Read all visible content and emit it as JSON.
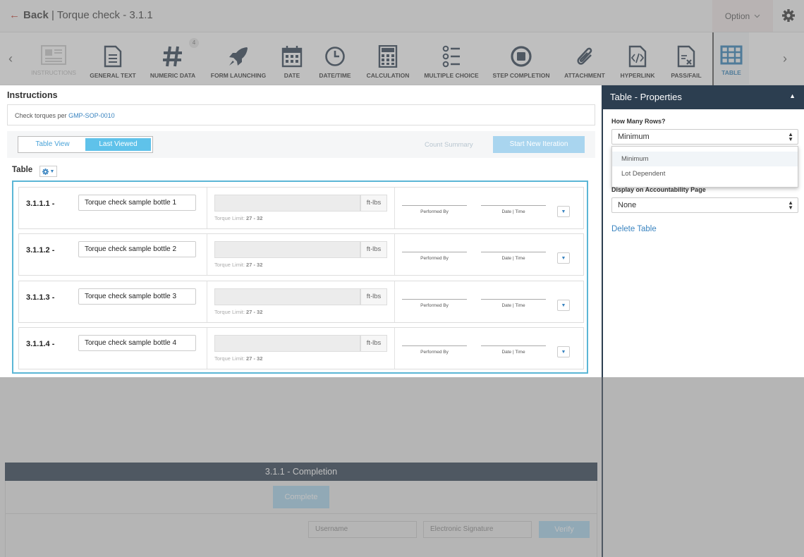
{
  "header": {
    "back_label": "Back",
    "title": "| Torque check - 3.1.1",
    "option_label": "Option"
  },
  "toolbar": {
    "items": [
      {
        "label": "INSTRUCTIONS"
      },
      {
        "label": "GENERAL TEXT"
      },
      {
        "label": "NUMERIC DATA",
        "badge": "4"
      },
      {
        "label": "FORM LAUNCHING"
      },
      {
        "label": "DATE"
      },
      {
        "label": "DATE/TIME"
      },
      {
        "label": "CALCULATION"
      },
      {
        "label": "MULTIPLE CHOICE"
      },
      {
        "label": "STEP COMPLETION"
      },
      {
        "label": "ATTACHMENT"
      },
      {
        "label": "HYPERLINK"
      },
      {
        "label": "PASS/FAIL"
      },
      {
        "label": "TABLE"
      }
    ]
  },
  "instructions": {
    "heading": "Instructions",
    "text": "Check torques per",
    "link": "GMP-SOP-0010"
  },
  "view_bar": {
    "table_view": "Table View",
    "last_viewed": "Last Viewed",
    "count_summary": "Count Summary",
    "start_iteration": "Start New Iteration"
  },
  "table": {
    "heading": "Table",
    "rows": [
      {
        "id": "3.1.1.1 -",
        "name": "Torque check sample bottle 1",
        "unit": "ft-lbs",
        "limit_label": "Torque Limit:",
        "limit_value": "27 - 32",
        "performed_by": "Performed By",
        "date_time": "Date | Time"
      },
      {
        "id": "3.1.1.2 -",
        "name": "Torque check sample bottle 2",
        "unit": "ft-lbs",
        "limit_label": "Torque Limit:",
        "limit_value": "27 - 32",
        "performed_by": "Performed By",
        "date_time": "Date | Time"
      },
      {
        "id": "3.1.1.3 -",
        "name": "Torque check sample bottle 3",
        "unit": "ft-lbs",
        "limit_label": "Torque Limit:",
        "limit_value": "27 - 32",
        "performed_by": "Performed By",
        "date_time": "Date | Time"
      },
      {
        "id": "3.1.1.4 -",
        "name": "Torque check sample bottle 4",
        "unit": "ft-lbs",
        "limit_label": "Torque Limit:",
        "limit_value": "27 - 32",
        "performed_by": "Performed By",
        "date_time": "Date | Time"
      }
    ]
  },
  "properties": {
    "title": "Table - Properties",
    "rows_label": "How Many Rows?",
    "rows_value": "Minimum",
    "rows_options": [
      "Minimum",
      "Lot Dependent"
    ],
    "display_label": "Display on Accountability Page",
    "display_value": "None",
    "delete_label": "Delete Table"
  },
  "completion": {
    "title": "3.1.1 - Completion",
    "complete_label": "Complete",
    "username_placeholder": "Username",
    "signature_placeholder": "Electronic Signature",
    "verify_label": "Verify"
  },
  "colors": {
    "navy": "#2c3e50",
    "accent": "#5fc2ea",
    "link": "#3a84c0",
    "table_border": "#5bb6d6"
  }
}
